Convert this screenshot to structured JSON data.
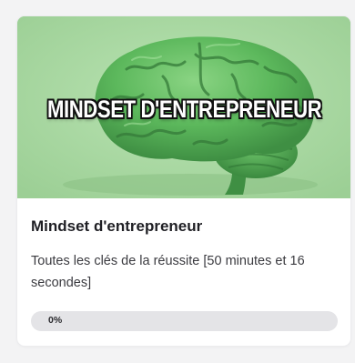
{
  "course": {
    "cover_text": "MINDSET D'ENTREPRENEUR",
    "title": "Mindset d'entrepreneur",
    "description": "Toutes les clés de la réussite [50 minutes et 16 secondes]",
    "progress": {
      "label": "0%",
      "value": 0
    }
  },
  "colors": {
    "cover_background": "#a7d7a0",
    "brain": "#5cb85c",
    "progress_track": "#e4e4e7"
  }
}
